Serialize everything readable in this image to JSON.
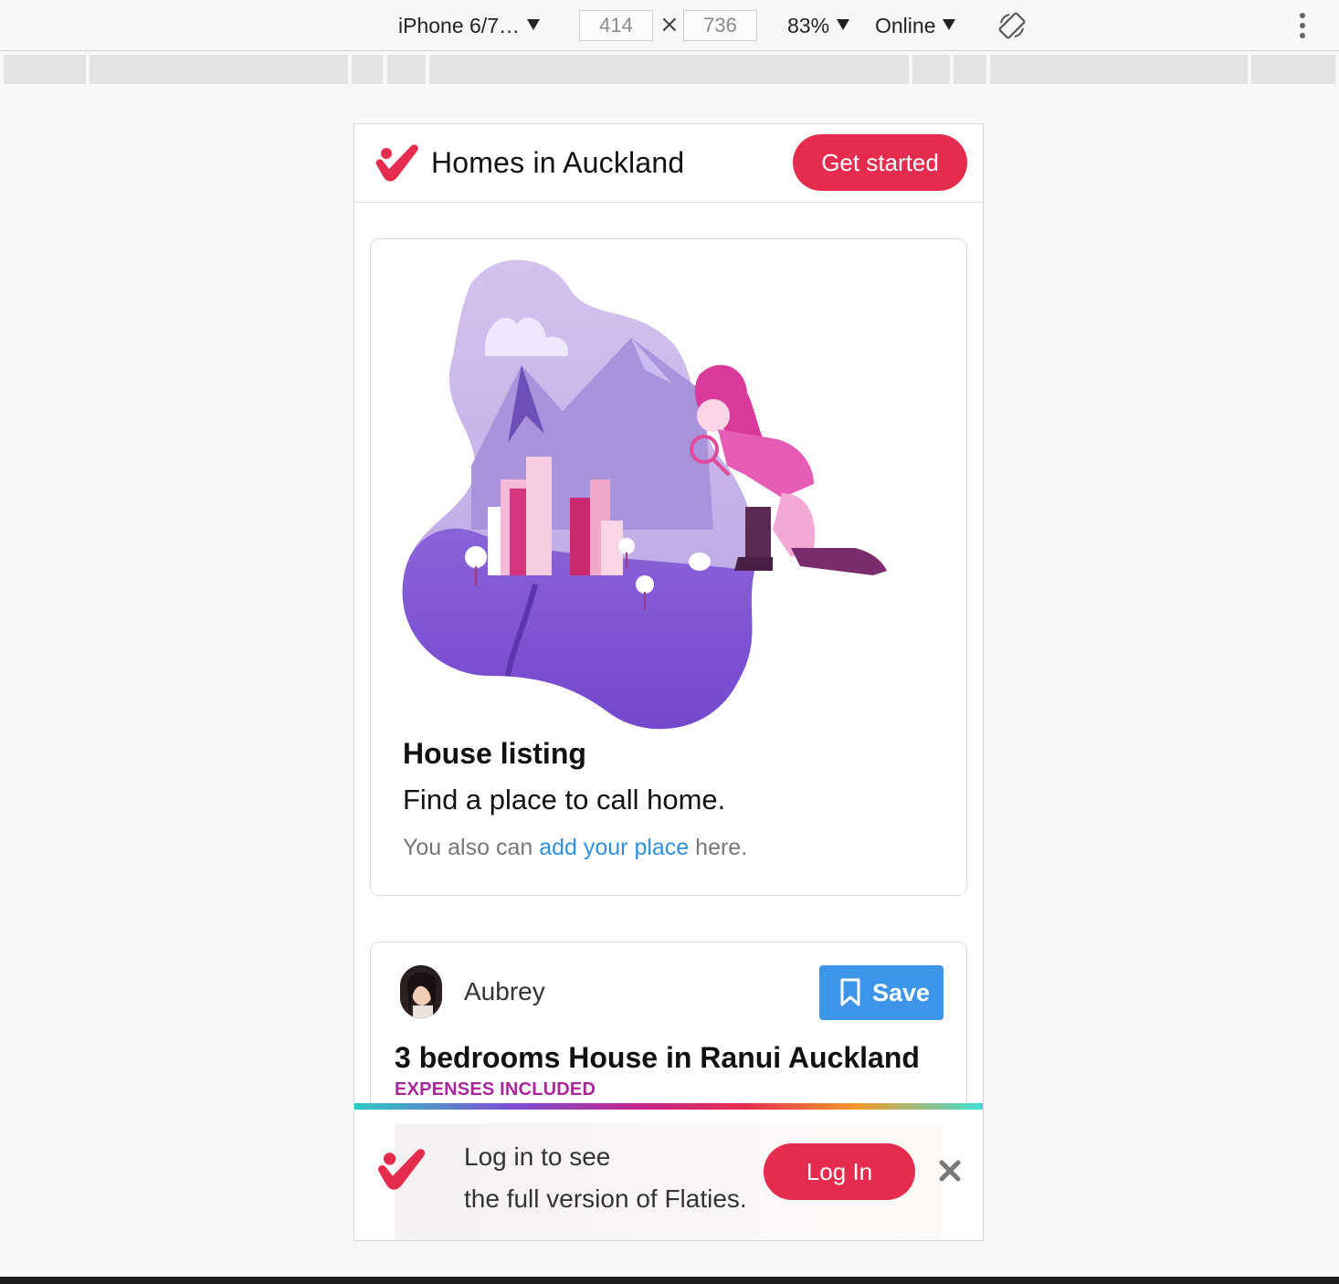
{
  "devtools": {
    "device_label": "iPhone 6/7…",
    "width_value": "414",
    "height_value": "736",
    "times_glyph": "×",
    "zoom_label": "83%",
    "network_label": "Online"
  },
  "header": {
    "title": "Homes in Auckland",
    "cta_label": "Get started"
  },
  "hero_card": {
    "heading": "House listing",
    "lead": "Find a place to call home.",
    "note_prefix": "You also can ",
    "note_link": "add your place",
    "note_suffix": " here."
  },
  "listing_card": {
    "poster_name": "Aubrey",
    "save_label": "Save",
    "title": "3 bedrooms House in Ranui Auckland",
    "tag": "EXPENSES INCLUDED"
  },
  "login_banner": {
    "line1": "Log in to see",
    "line2": "the full version of Flaties.",
    "login_label": "Log In"
  },
  "colors": {
    "brand": "#e62c4e",
    "link": "#2f8fe0",
    "save": "#3d95ea",
    "tag": "#a8279a"
  },
  "icons": [
    "flaties-logo",
    "caret-down-icon",
    "rotate-icon",
    "more-vert-icon",
    "bookmark-icon",
    "close-icon"
  ]
}
